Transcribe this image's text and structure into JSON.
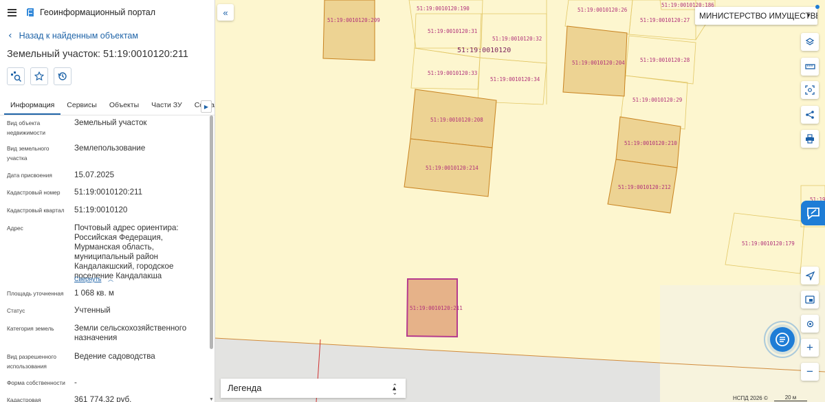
{
  "header": {
    "title": "Геоинформационный портал"
  },
  "back_link": "Назад к найденным объектам",
  "object_title": "Земельный участок: 51:19:0010120:211",
  "tabs": [
    "Информация",
    "Сервисы",
    "Объекты",
    "Части ЗУ",
    "Состав"
  ],
  "properties": [
    {
      "label": "Вид объекта недвижимости",
      "value": "Земельный участок"
    },
    {
      "label": "Вид земельного участка",
      "value": "Землепользование"
    },
    {
      "label": "Дата присвоения",
      "value": "15.07.2025"
    },
    {
      "label": "Кадастровый номер",
      "value": "51:19:0010120:211"
    },
    {
      "label": "Кадастровый квартал",
      "value": "51:19:0010120"
    },
    {
      "label": "Адрес",
      "value": "Почтовый адрес ориентира: Российская Федерация, Мурманская область, муниципальный район Кандалакшский, городское поселение Кандалакша"
    },
    {
      "label": "Площадь уточненная",
      "value": "1 068 кв. м"
    },
    {
      "label": "Статус",
      "value": "Учтенный"
    },
    {
      "label": "Категория земель",
      "value": "Земли сельскохозяйственного назначения"
    },
    {
      "label": "Вид разрешенного использования",
      "value": "Ведение садоводства"
    },
    {
      "label": "Форма собственности",
      "value": "-"
    },
    {
      "label": "Кадастровая",
      "value": "361 774,32 руб."
    }
  ],
  "collapse_link": "Свернуть",
  "map": {
    "ministry_select": "МИНИСТЕРСТВО ИМУЩЕСТВЕННЫХ ОТНОШЕНИЙ",
    "legend_label": "Легенда",
    "attribution": "НСПД 2026 ©",
    "scale_label": "20 м",
    "quarter_label": "51:19:0010120",
    "parcels": [
      {
        "id": "51:19:0010120:209",
        "kind": "fill"
      },
      {
        "id": "51:19:0010120:204",
        "kind": "fill"
      },
      {
        "id": "51:19:0010120:208",
        "kind": "fill"
      },
      {
        "id": "51:19:0010120:214",
        "kind": "fill"
      },
      {
        "id": "51:19:0010120:210",
        "kind": "fill"
      },
      {
        "id": "51:19:0010120:212",
        "kind": "fill"
      },
      {
        "id": "51:19:0010120:211",
        "kind": "selected"
      },
      {
        "id": "51:19:0010120:190",
        "kind": "outline"
      },
      {
        "id": "51:19:0010120:31",
        "kind": "outline"
      },
      {
        "id": "51:19:0010120:32",
        "kind": "outline"
      },
      {
        "id": "51:19:0010120:33",
        "kind": "outline"
      },
      {
        "id": "51:19:0010120:34",
        "kind": "outline"
      },
      {
        "id": "51:19:0010120:26",
        "kind": "outline"
      },
      {
        "id": "51:19:0010120:27",
        "kind": "outline"
      },
      {
        "id": "51:19:0010120:28",
        "kind": "outline"
      },
      {
        "id": "51:19:0010120:29",
        "kind": "outline"
      },
      {
        "id": "51:19:0010120:186",
        "kind": "outline"
      },
      {
        "id": "51:19:0010120:179",
        "kind": "outline"
      },
      {
        "id": "51:19",
        "kind": "outline"
      }
    ]
  },
  "icons": {
    "menu": "hamburger-icon",
    "logo": "portal-logo-icon",
    "back": "chevron-left-icon",
    "action1": "zoom-to-object-icon",
    "action2": "star-icon",
    "action3": "history-icon",
    "collapse": "double-chevron-left-icon",
    "layers": "layers-icon",
    "measure": "ruler-icon",
    "select_area": "area-select-icon",
    "share": "share-icon",
    "print": "print-icon",
    "locate": "navigation-arrow-icon",
    "basemap": "basemap-icon",
    "geo": "geolocation-icon",
    "zoom_in": "plus-icon",
    "zoom_out": "minus-icon",
    "chat": "chat-icon"
  },
  "colors": {
    "accent": "#1f64a8",
    "map_bg": "#fdf6cf",
    "parcel_fill": "#edd393",
    "parcel_stroke": "#c8821f",
    "selected_fill": "#e6b289",
    "selected_stroke": "#b53a8e",
    "label": "#b0307a"
  }
}
